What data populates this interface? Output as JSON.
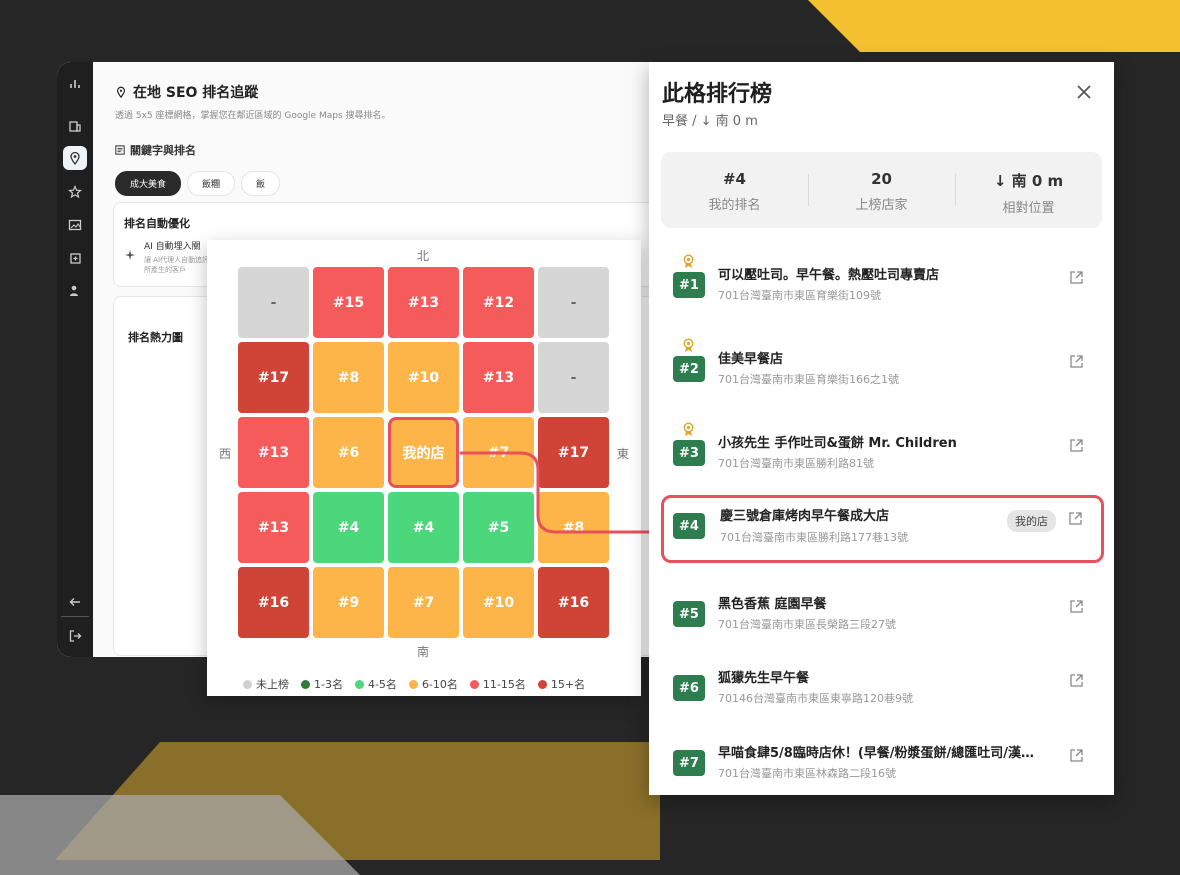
{
  "colors": {
    "background": "#262626",
    "accent_yellow": "#f4c030",
    "mine_highlight": "#e8505b",
    "rank_badge": "#2e7d4f"
  },
  "rail": {
    "icons": [
      "bar-chart-icon",
      "building-icon",
      "map-pin-icon",
      "star-icon",
      "image-icon",
      "add-content-icon",
      "user-icon",
      "back-arrow-icon",
      "logout-icon"
    ]
  },
  "main": {
    "title": "在地 SEO 排名追蹤",
    "subtitle": "透過 5x5 座標網格，掌握您在鄰近區域的 Google Maps 搜尋排名。",
    "section_title": "關鍵字與排名",
    "keywords": [
      "成大美食",
      "飯糰",
      "飯"
    ],
    "selected_keyword": "成大美食",
    "auto_card": {
      "title": "排名自動優化",
      "ai_label": "AI 自動埋入關",
      "ai_desc": "讓 AI代理人自動追評」所產生的客戶"
    },
    "heatmap_card_title": "排名熱力圖"
  },
  "heatmap": {
    "compass": {
      "north": "北",
      "south": "南",
      "west": "西",
      "east": "東"
    },
    "grid": [
      [
        {
          "label": "-",
          "tier": "none"
        },
        {
          "label": "#15",
          "tier": "1115"
        },
        {
          "label": "#13",
          "tier": "1115"
        },
        {
          "label": "#12",
          "tier": "1115"
        },
        {
          "label": "-",
          "tier": "none"
        }
      ],
      [
        {
          "label": "#17",
          "tier": "15p"
        },
        {
          "label": "#8",
          "tier": "610"
        },
        {
          "label": "#10",
          "tier": "610"
        },
        {
          "label": "#13",
          "tier": "1115"
        },
        {
          "label": "-",
          "tier": "none"
        }
      ],
      [
        {
          "label": "#13",
          "tier": "1115"
        },
        {
          "label": "#6",
          "tier": "610"
        },
        {
          "label": "我的店",
          "tier": "610",
          "mine": true
        },
        {
          "label": "#7",
          "tier": "610"
        },
        {
          "label": "#17",
          "tier": "15p"
        }
      ],
      [
        {
          "label": "#13",
          "tier": "1115"
        },
        {
          "label": "#4",
          "tier": "45"
        },
        {
          "label": "#4",
          "tier": "45"
        },
        {
          "label": "#5",
          "tier": "45"
        },
        {
          "label": "#8",
          "tier": "610"
        }
      ],
      [
        {
          "label": "#16",
          "tier": "15p"
        },
        {
          "label": "#9",
          "tier": "610"
        },
        {
          "label": "#7",
          "tier": "610"
        },
        {
          "label": "#10",
          "tier": "610"
        },
        {
          "label": "#16",
          "tier": "15p"
        }
      ]
    ],
    "legend": [
      {
        "label": "未上榜",
        "color": "#d0d0d0"
      },
      {
        "label": "1-3名",
        "color": "#2e7d32"
      },
      {
        "label": "4-5名",
        "color": "#4cd87a"
      },
      {
        "label": "6-10名",
        "color": "#fdb54a"
      },
      {
        "label": "11-15名",
        "color": "#f65b5b"
      },
      {
        "label": "15+名",
        "color": "#cf4436"
      }
    ]
  },
  "rank_panel": {
    "title": "此格排行榜",
    "subtitle": "早餐 / ↓ 南 0 m",
    "stats": [
      {
        "value": "#4",
        "label": "我的排名"
      },
      {
        "value": "20",
        "label": "上榜店家"
      },
      {
        "value": "↓ 南 0 m",
        "label": "相對位置"
      }
    ],
    "mine_tag": "我的店",
    "items": [
      {
        "rank": "#1",
        "name": "可以壓吐司。早午餐。熱壓吐司專賣店",
        "address": "701台灣臺南市東區育樂街109號",
        "medal": true
      },
      {
        "rank": "#2",
        "name": "佳美早餐店",
        "address": "701台灣臺南市東區育樂街166之1號",
        "medal": true
      },
      {
        "rank": "#3",
        "name": "小孩先生 手作吐司&蛋餅 Mr. Children",
        "address": "701台灣臺南市東區勝利路81號",
        "medal": true
      },
      {
        "rank": "#4",
        "name": "慶三號倉庫烤肉早午餐成大店",
        "address": "701台灣臺南市東區勝利路177巷13號",
        "mine": true
      },
      {
        "rank": "#5",
        "name": "黑色香蕉 庭園早餐",
        "address": "701台灣臺南市東區長榮路三段27號"
      },
      {
        "rank": "#6",
        "name": "狐獴先生早午餐",
        "address": "70146台灣臺南市東區東寧路120巷9號"
      },
      {
        "rank": "#7",
        "name": "早喵食肆5/8臨時店休！(早餐/粉漿蛋餅/總匯吐司/漢…",
        "address": "701台灣臺南市東區林森路二段16號"
      }
    ]
  }
}
